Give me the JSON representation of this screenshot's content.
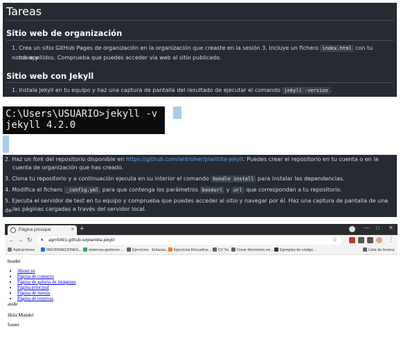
{
  "tareas": {
    "title": "Tareas",
    "org_heading": "Sitio web de organización",
    "org_item": {
      "num": "1.",
      "line1_a": "Crea un sitio GitHub Pages de organización en la organización que creaste en la sesión 3. Incluye un fichero",
      "line1_code": "index.html",
      "line1_b": "con tu nombre y",
      "line2": "tus apellidos. Comprueba que puedes acceder vía web al sitio publicado."
    },
    "jekyll_heading": "Sitio web con Jekyll",
    "jekyll_item": {
      "num": "1.",
      "text_a": "Instala Jekyll en tu equipo y haz una captura de pantalla del resultado de ejecutar el comando",
      "code": "jekyll -version",
      "text_b": "."
    }
  },
  "terminal": {
    "line1": "C:\\Users\\USUARIO>jekyll -v",
    "line2": "jekyll 4.2.0"
  },
  "steps": {
    "s2": {
      "num": "2.",
      "a": "Haz un",
      "em": "fork",
      "b": "del repositorio disponible en",
      "link": "https://github.com/antroher/plantilla-jekyll",
      "c": ". Puedes crear el repositorio en tu cuenta o en la",
      "line2": "cuenta de organización que has creado."
    },
    "s3": {
      "num": "3.",
      "a": "Clona tu repositorio y a continuación ejecuta en su interior el comando",
      "code": "bundle install",
      "b": "para instalar las dependencias."
    },
    "s4": {
      "num": "4.",
      "a": "Modifica el fichero",
      "code1": "_config.yml",
      "b": "para que contenga los parámetros",
      "code2": "baseurl",
      "c": "y",
      "code3": "url",
      "d": "que correspondan a tu repositorio."
    },
    "s5": {
      "num": "5.",
      "line1": "Ejecuta el servidor de test en tu equipo y comprueba que puedes acceder al sitio y navegar por él. Haz una captura de pantalla de una de",
      "line2": "las páginas cargadas a través del servidor local."
    }
  },
  "browser": {
    "tab_title": "Página principal",
    "tab_close": "×",
    "new_tab": "+",
    "win_min": "—",
    "win_max": "□",
    "win_close": "✕",
    "url": "agm5491.github.io/plantilla-jekyll/",
    "bookmarks": [
      {
        "label": "Aplicaciones",
        "color": "#7a7a7a"
      },
      {
        "label": "INFORMACIONES...",
        "color": "#1a73e8"
      },
      {
        "label": "sistemas-gestores-...",
        "color": "#34a853"
      },
      {
        "label": "Ejercicios - Enlaces...",
        "color": "#5f6368"
      },
      {
        "label": "Ejercicios Resueltos...",
        "color": "#ea8600"
      },
      {
        "label": "C# Ya",
        "color": "#5f6368"
      },
      {
        "label": "Crear directorios en...",
        "color": "#5f6368"
      },
      {
        "label": "Ejemplos de código...",
        "color": "#333333"
      }
    ],
    "reading_list": "Lista de lectura",
    "page": {
      "header": "header",
      "links": [
        "About us",
        "Página de contacto",
        "Página de galería de imágenes",
        "Página principal",
        "Página de menús",
        "Página de reservas"
      ],
      "aside": "aside",
      "content": "Hola Mundo!",
      "footer": "footer"
    }
  }
}
